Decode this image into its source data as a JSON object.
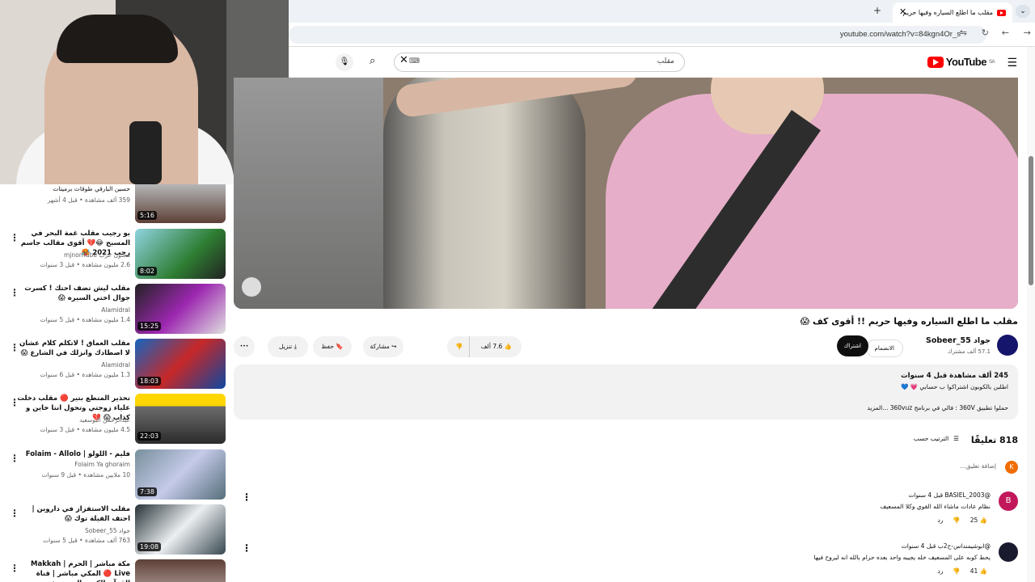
{
  "browser": {
    "tab_title": "مقلب ما اطلع السياره وفيها حريم",
    "url": "youtube.com/watch?v=84kgn4Or_s",
    "new_tab": "+",
    "close": "✕",
    "tab_menu": "⌄"
  },
  "yt": {
    "logo": "YouTube",
    "country": "SA",
    "search_value": "مقلب"
  },
  "recs": [
    {
      "title": "حسين البارقي طوقات برميتات",
      "channel": "",
      "meta": "359 ألف مشاهدة • قبل 4 أشهر",
      "duration": "5:16"
    },
    {
      "title": "بو رجيب مقلب غمة البحر في المسبح 😂💔 أقوى مقالب جاسم رجب 2021 🥵",
      "channel": "مجنون عرب mjnonTube",
      "meta": "2.6 مليون مشاهدة • قبل 3 سنوات",
      "duration": "8:02"
    },
    {
      "title": "مقلب ليش تضف احتك ! كسرت جوال اختي السيره 😱",
      "channel": "Alamidral",
      "meta": "1.4 مليون مشاهدة • قبل 5 سنوات",
      "duration": "15:25"
    },
    {
      "title": "مقلب العماق ! لاتكلم كلام عشان لا اصطادك وانزلك في الشارع 😱",
      "channel": "Alamidral",
      "meta": "1.3 مليون مشاهدة • قبل 6 سنوات",
      "duration": "18:03"
    },
    {
      "title": "تحذير المتطع بتير 🔴 مقلب دخلت علياء زوجتي وتحول انتا خاين و كذاب 😱 💔",
      "channel": "عبدالرحمن البوسعيد",
      "meta": "4.5 مليون مشاهدة • قبل 3 سنوات",
      "duration": "22:03"
    },
    {
      "title": "فليم - اللولو | Folaim - Allolo",
      "channel": "Folaim Ya ghoraim",
      "meta": "10 ملايين مشاهدة • قبل 9 سنوات",
      "duration": "7:38"
    },
    {
      "title": "مقلب الاستفزاز في داروين | احتف الفيلة توك 😱",
      "channel": "جواد Sobeer_55",
      "meta": "763 ألف مشاهدة • قبل 5 سنوات",
      "duration": "19:08"
    },
    {
      "title": "مكة مباشر | الحرم | Makkah Live 🔴 المكي مباشر | قناة القرآن الكريم السعودية ...",
      "channel": "",
      "meta": "",
      "duration": ""
    }
  ],
  "video": {
    "title": "مقلب ما اطلع السياره وفيها حريم !! أقوى كف 😱",
    "channel": "جواد Sobeer_55",
    "subs": "57.1 ألف مشترك",
    "join": "الانضمام",
    "subscribe": "اشتراك",
    "likes": "7.6 ألف",
    "share": "مشاركة",
    "save": "حفظ",
    "download": "تنزيل",
    "more": "•••"
  },
  "description": {
    "views": "245 ألف مشاهدة  قبل 4 سنوات",
    "line1": "اطلبن بالكوبون اشتراكوا ب حسابي 💗 💙",
    "line2": "حملوا تطبيق 360V : فالي في برنامج 360vuz   ...المزيد"
  },
  "comments": {
    "count": "818 تعليقًا",
    "sort": "الترتيب حسب",
    "add": "إضافة تعليق...",
    "me_initial": "K",
    "list": [
      {
        "initial": "B",
        "color": "#c2185b",
        "author": "@BASIEL_2003 قبل 4 سنوات",
        "text": "نظام عادات ماشاء الله القوي وكلا المسعيف",
        "likes": "25",
        "reply": "رد"
      },
      {
        "initial": "",
        "color": "#1a1a2e",
        "author": "@ابوشيمنداس-ح2ب قبل 4 سنوات",
        "text": "يحط كوبه على المسعيف خله يجيبه واحد بعده حرام بالله انه ليروح فيها",
        "likes": "41",
        "reply": "رد"
      }
    ]
  }
}
